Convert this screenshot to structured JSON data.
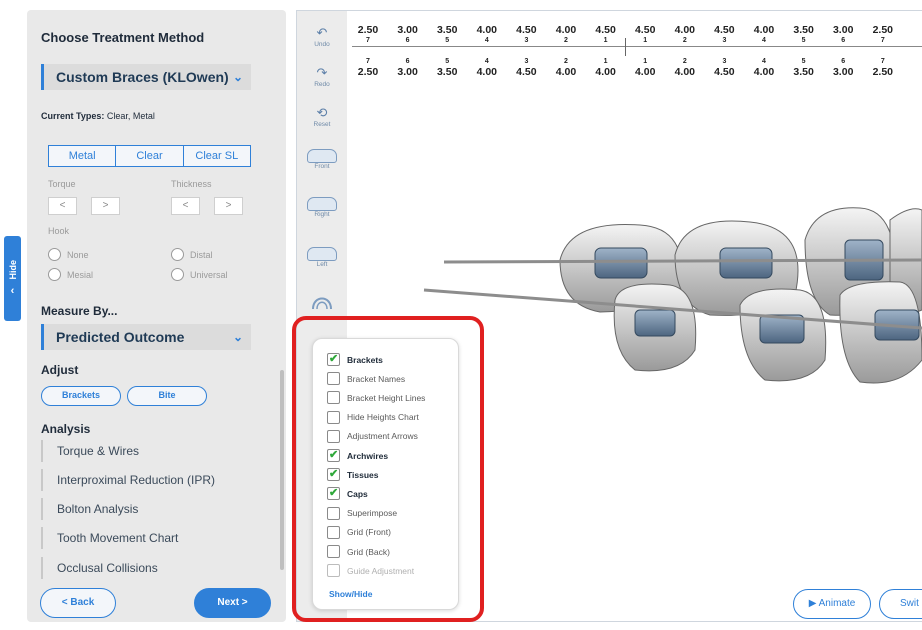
{
  "hide_tab": {
    "label": "Hide"
  },
  "left_panel": {
    "title": "Choose Treatment Method",
    "method_dropdown": {
      "value": "Custom Braces (KLOwen)"
    },
    "current_types_label": "Current Types:",
    "current_types_value": "Clear, Metal",
    "type_options": [
      "Metal",
      "Clear",
      "Clear SL"
    ],
    "torque_label": "Torque",
    "thickness_label": "Thickness",
    "hook_label": "Hook",
    "hook_options": [
      "None",
      "Distal",
      "Mesial",
      "Universal"
    ],
    "measure_by_title": "Measure By...",
    "measure_dropdown": {
      "value": "Predicted Outcome"
    },
    "adjust_title": "Adjust",
    "adjust_buttons": [
      "Brackets",
      "Bite"
    ],
    "analysis_title": "Analysis",
    "analysis_items": [
      "Torque & Wires",
      "Interproximal Reduction (IPR)",
      "Bolton Analysis",
      "Tooth Movement Chart",
      "Occlusal Collisions"
    ],
    "back_label": "< Back",
    "next_label": "Next >"
  },
  "toolbar": {
    "undo": "Undo",
    "redo": "Redo",
    "reset": "Reset",
    "front": "Front",
    "right": "Right",
    "left": "Left"
  },
  "heights_chart": {
    "upper_values": [
      "2.50",
      "3.00",
      "3.50",
      "4.00",
      "4.50",
      "4.00",
      "4.50",
      "4.50",
      "4.00",
      "4.50",
      "4.00",
      "3.50",
      "3.00",
      "2.50"
    ],
    "upper_numbers": [
      "7",
      "6",
      "5",
      "4",
      "3",
      "2",
      "1",
      "1",
      "2",
      "3",
      "4",
      "5",
      "6",
      "7"
    ],
    "lower_numbers": [
      "7",
      "6",
      "5",
      "4",
      "3",
      "2",
      "1",
      "1",
      "2",
      "3",
      "4",
      "5",
      "6",
      "7"
    ],
    "lower_values": [
      "2.50",
      "3.00",
      "3.50",
      "4.00",
      "4.50",
      "4.00",
      "4.00",
      "4.00",
      "4.00",
      "4.50",
      "4.00",
      "3.50",
      "3.00",
      "2.50"
    ]
  },
  "popup": {
    "items": [
      {
        "label": "Brackets",
        "checked": true,
        "disabled": false
      },
      {
        "label": "Bracket Names",
        "checked": false,
        "disabled": false
      },
      {
        "label": "Bracket Height Lines",
        "checked": false,
        "disabled": false
      },
      {
        "label": "Hide Heights Chart",
        "checked": false,
        "disabled": false
      },
      {
        "label": "Adjustment Arrows",
        "checked": false,
        "disabled": false
      },
      {
        "label": "Archwires",
        "checked": true,
        "disabled": false
      },
      {
        "label": "Tissues",
        "checked": true,
        "disabled": false
      },
      {
        "label": "Caps",
        "checked": true,
        "disabled": false
      },
      {
        "label": "Superimpose",
        "checked": false,
        "disabled": false
      },
      {
        "label": "Grid (Front)",
        "checked": false,
        "disabled": false
      },
      {
        "label": "Grid (Back)",
        "checked": false,
        "disabled": false
      },
      {
        "label": "Guide Adjustment",
        "checked": false,
        "disabled": true
      }
    ],
    "show_hide_label": "Show/Hide"
  },
  "bottom_buttons": {
    "animate": "Animate",
    "switch_partial": "Swit"
  },
  "colors": {
    "accent": "#2f80d8",
    "highlight_frame": "#e02020",
    "check": "#2fa83a"
  }
}
